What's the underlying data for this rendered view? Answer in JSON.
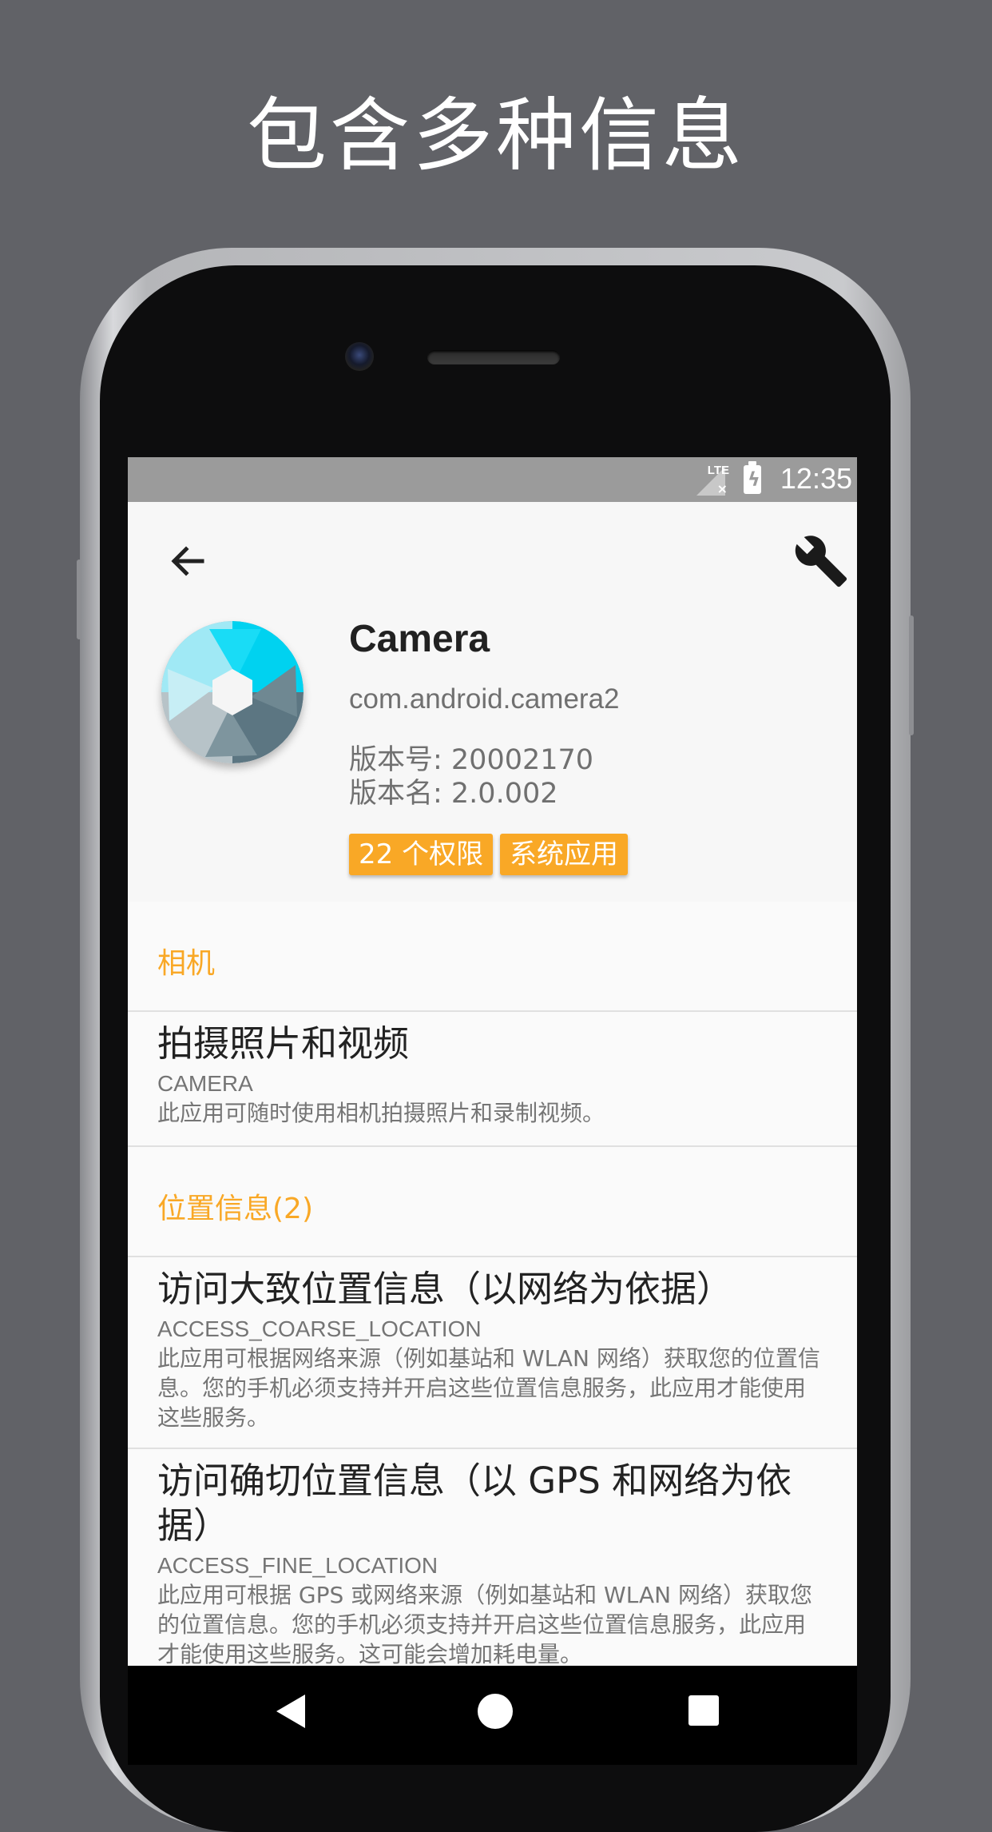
{
  "promo": {
    "title": "包含多种信息"
  },
  "status_bar": {
    "network": "LTE",
    "time": "12:35"
  },
  "toolbar": {
    "back_icon": "back-arrow-icon",
    "settings_icon": "wrench-icon"
  },
  "app": {
    "name": "Camera",
    "package": "com.android.camera2",
    "version_code": "版本号: 20002170",
    "version_name": "版本名: 2.0.002",
    "badges": {
      "permissions": "22 个权限",
      "system": "系统应用"
    }
  },
  "sections": [
    {
      "title": "相机",
      "items": [
        {
          "title": "拍摄照片和视频",
          "constant": "CAMERA",
          "description": "此应用可随时使用相机拍摄照片和录制视频。"
        }
      ]
    },
    {
      "title": "位置信息(2)",
      "items": [
        {
          "title": "访问大致位置信息（以网络为依据）",
          "constant": "ACCESS_COARSE_LOCATION",
          "description": "此应用可根据网络来源（例如基站和 WLAN 网络）获取您的位置信息。您的手机必须支持并开启这些位置信息服务，此应用才能使用这些服务。"
        },
        {
          "title": "访问确切位置信息（以 GPS 和网络为依据）",
          "constant": "ACCESS_FINE_LOCATION",
          "description": "此应用可根据 GPS 或网络来源（例如基站和 WLAN 网络）获取您的位置信息。您的手机必须支持并开启这些位置信息服务，此应用才能使用这些服务。这可能会增加耗电量。"
        }
      ]
    }
  ],
  "colors": {
    "accent": "#f9a826",
    "background": "#616267",
    "status_bar": "#9b9b9b"
  },
  "nav_bar": {
    "back_icon": "nav-back-icon",
    "home_icon": "nav-home-icon",
    "recents_icon": "nav-recents-icon"
  }
}
